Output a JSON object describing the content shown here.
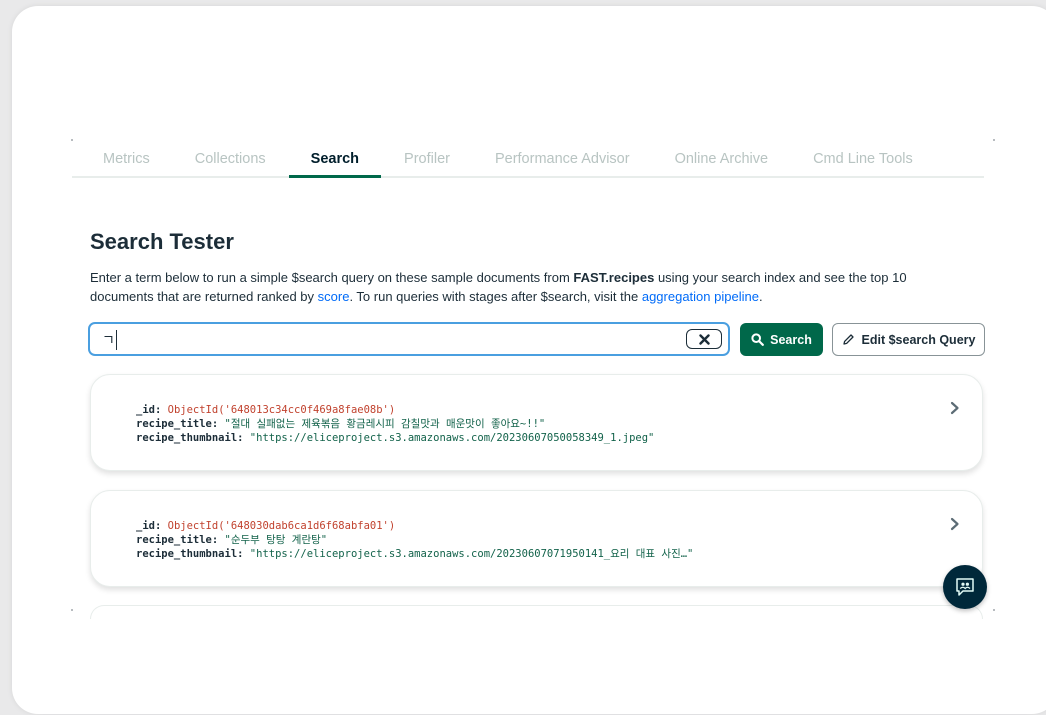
{
  "tabs": [
    {
      "label": "Metrics"
    },
    {
      "label": "Collections"
    },
    {
      "label": "Search",
      "active": true
    },
    {
      "label": "Profiler"
    },
    {
      "label": "Performance Advisor"
    },
    {
      "label": "Online Archive"
    },
    {
      "label": "Cmd Line Tools"
    }
  ],
  "tester": {
    "title": "Search Tester",
    "desc_part1": "Enter a term below to run a simple $search query on these sample documents from ",
    "desc_collection": "FAST.recipes",
    "desc_part2": " using your search index and see the top 10 documents that are returned ranked by ",
    "desc_link_score": "score",
    "desc_part3": ". To run queries with stages after $search, visit the ",
    "desc_link_pipeline": "aggregation pipeline",
    "desc_part4": "."
  },
  "search": {
    "value": "ㄱ",
    "clear_icon": "x-icon",
    "button_label": "Search",
    "button_icon": "magnifier-icon",
    "edit_label": "Edit $search Query",
    "edit_icon": "pencil-icon"
  },
  "results": [
    {
      "id_key": "_id:",
      "id_value": "ObjectId('648013c34cc0f469a8fae08b')",
      "title_key": "recipe_title:",
      "title_value": "\"절대 실패없는 제육볶음 황금레시피 감칠맛과 매운맛이 좋아요~!!\"",
      "thumb_key": "recipe_thumbnail:",
      "thumb_value": "\"https://eliceproject.s3.amazonaws.com/20230607050058349_1.jpeg\""
    },
    {
      "id_key": "_id:",
      "id_value": "ObjectId('648030dab6ca1d6f68abfa01')",
      "title_key": "recipe_title:",
      "title_value": "\"순두부 탕탕 계란탕\"",
      "thumb_key": "recipe_thumbnail:",
      "thumb_value": "\"https://eliceproject.s3.amazonaws.com/20230607071950141_요리 대표 사진…\""
    }
  ],
  "colors": {
    "accent": "#00684a",
    "link": "#016bf8",
    "focus": "#4a9fe0",
    "object_id": "#c1422e",
    "string": "#12624a",
    "chat_button": "#00283a"
  }
}
